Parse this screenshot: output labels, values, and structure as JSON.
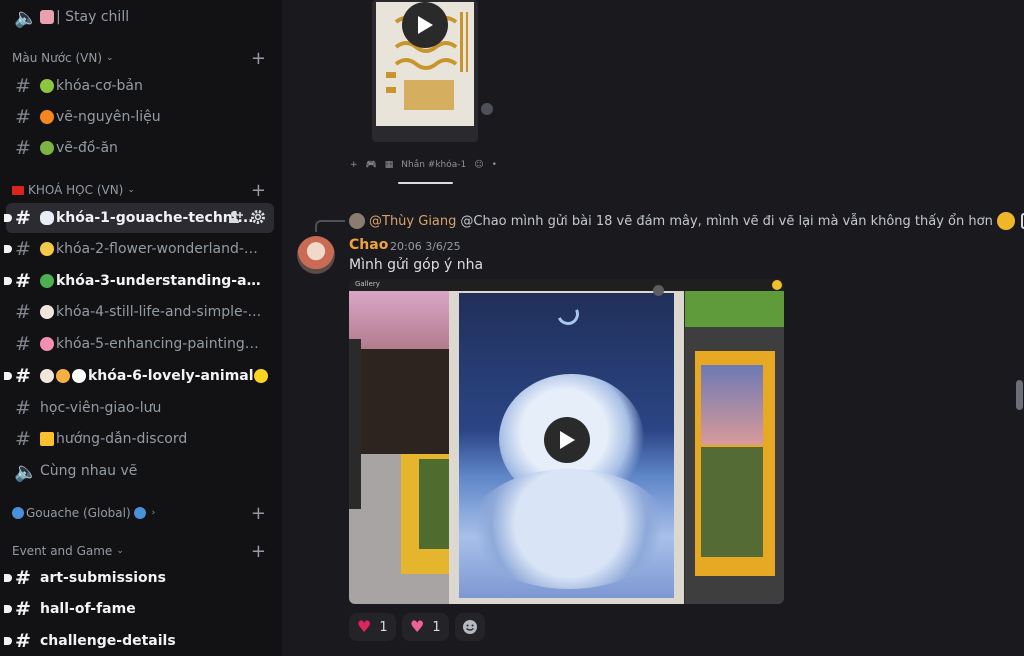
{
  "sidebar": {
    "top_item": {
      "label": "| Stay chill",
      "icon": "speaker-icon"
    },
    "categories": [
      {
        "label": "Màu Nước (VN)"
      },
      {
        "label": "KHOÁ HỌC (VN)"
      },
      {
        "label": "Gouache (Global)"
      },
      {
        "label": "Event and Game"
      }
    ],
    "channels": [
      {
        "label": "khóa-cơ-bản",
        "icon": "hash-icon"
      },
      {
        "label": "vẽ-nguyên-liệu",
        "icon": "hash-icon"
      },
      {
        "label": "vẽ-đồ-ăn",
        "icon": "hash-icon"
      },
      {
        "label": "khóa-1-gouache-techni...",
        "icon": "hash-icon"
      },
      {
        "label": "khóa-2-flower-wonderland-p...",
        "icon": "hash-icon"
      },
      {
        "label": "khóa-3-understanding-applyi...",
        "icon": "hash-icon"
      },
      {
        "label": "khóa-4-still-life-and-simple-...",
        "icon": "hash-icon"
      },
      {
        "label": "khóa-5-enhancing-paintings-...",
        "icon": "hash-icon"
      },
      {
        "label": "khóa-6-lovely-animal",
        "icon": "hash-icon"
      },
      {
        "label": "học-viên-giao-lưu",
        "icon": "hash-icon"
      },
      {
        "label": "hướng-dẫn-discord",
        "icon": "hash-icon"
      },
      {
        "label": "Cùng nhau vẽ",
        "icon": "speaker-icon"
      },
      {
        "label": "art-submissions",
        "icon": "hash-icon"
      },
      {
        "label": "hall-of-fame",
        "icon": "hash-icon"
      },
      {
        "label": "challenge-details",
        "icon": "hash-icon"
      }
    ]
  },
  "main": {
    "mini_input_placeholder": "Nhắn #khóa-1",
    "reply": {
      "name": "@Thùy Giang",
      "text": "@Chao mình gửi bài 18 vẽ đám mây, mình vẽ đi vẽ lại mà vẫn không thấy ổn hơn"
    },
    "message": {
      "author": "Chao",
      "timestamp": "20:06 3/6/25",
      "text": "Mình gửi góp ý nha"
    },
    "media_app_label": "Gallery",
    "reactions": [
      {
        "icon": "heart-icon",
        "count": "1"
      },
      {
        "icon": "sparkling-heart-icon",
        "count": "1"
      }
    ]
  },
  "colors": {
    "sidebar_bg": "#121214",
    "main_bg": "#1a1a1e",
    "author": "#f0a33b",
    "reply_name": "#d8a36a"
  }
}
